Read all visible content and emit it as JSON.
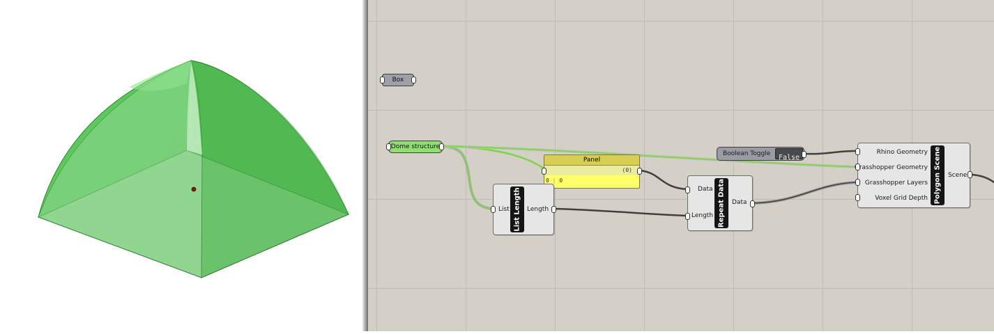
{
  "viewport": {
    "object_color": "#55c455"
  },
  "canvas": {
    "background": "#d4d0c8",
    "wire_color": "#404040"
  },
  "components": {
    "box": {
      "label": "Box"
    },
    "dome_structure": {
      "label": "Dome structure",
      "color": "#8fe070"
    },
    "panel": {
      "title": "Panel",
      "path": "(0)",
      "row_index": "0",
      "row_value": "0",
      "color": "#ffff6a"
    },
    "list_length": {
      "title": "List Length",
      "input": "List",
      "output": "Length"
    },
    "repeat_data": {
      "title": "Repeat Data",
      "inputs": [
        "Data",
        "Length"
      ],
      "output": "Data"
    },
    "boolean_toggle": {
      "label": "Boolean Toggle",
      "value": "False"
    },
    "polygon_scene": {
      "title": "Polygon Scene",
      "inputs": [
        "Rhino Geometry",
        "Grasshopper Geometry",
        "Grasshopper Layers",
        "Voxel Grid Depth"
      ],
      "output": "Scene"
    }
  }
}
